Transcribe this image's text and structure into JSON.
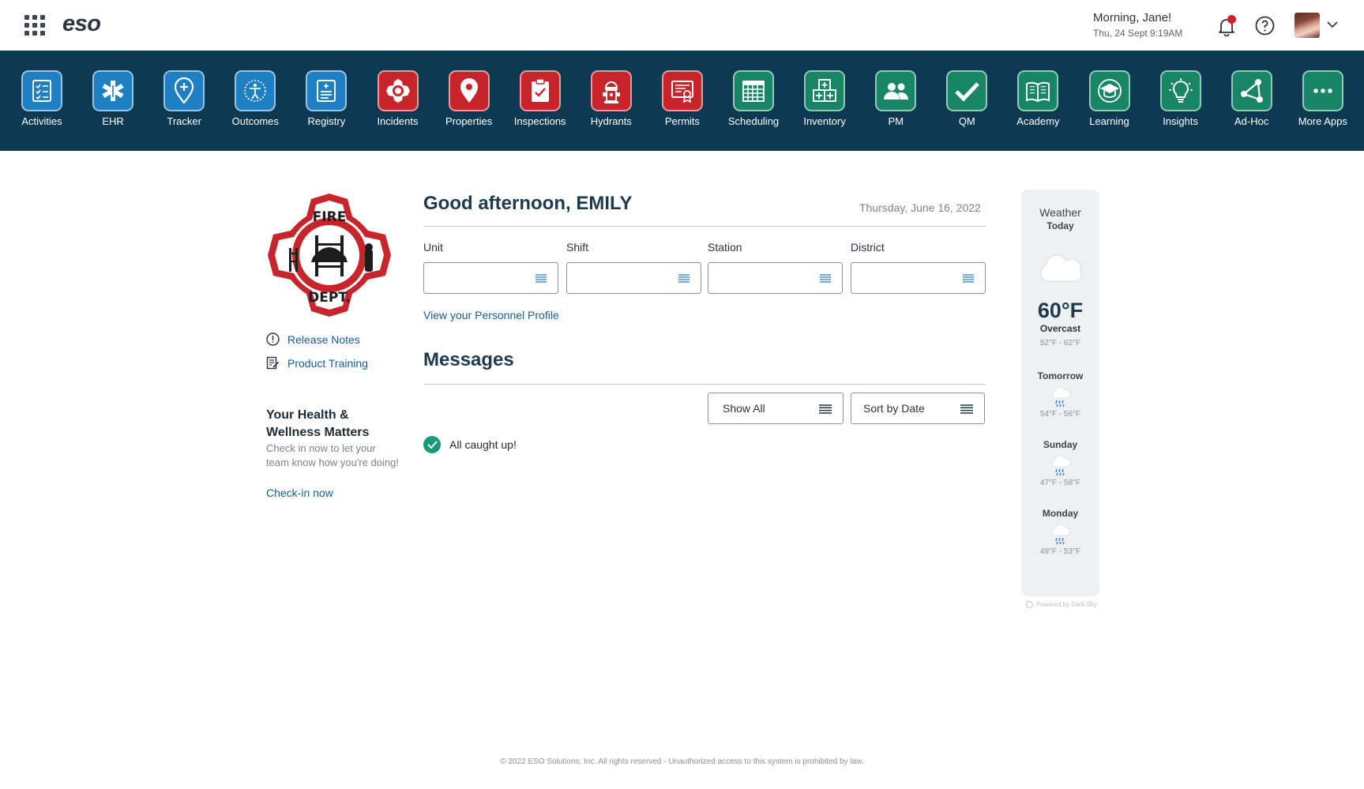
{
  "header": {
    "logo": "eso",
    "greeting": "Morning, Jane!",
    "datetime": "Thu, 24 Sept 9:19AM",
    "icons": [
      "apps-grid-icon",
      "bell-icon",
      "help-icon",
      "avatar",
      "chevron-down-icon"
    ],
    "notification_dot_color": "#d0202a"
  },
  "apps": [
    {
      "label": "Activities",
      "color": "blue",
      "icon": "checklist-icon"
    },
    {
      "label": "EHR",
      "color": "blue",
      "icon": "star-of-life-icon"
    },
    {
      "label": "Tracker",
      "color": "blue",
      "icon": "location-plus-icon"
    },
    {
      "label": "Outcomes",
      "color": "blue",
      "icon": "person-circle-icon"
    },
    {
      "label": "Registry",
      "color": "blue",
      "icon": "registry-icon"
    },
    {
      "label": "Incidents",
      "color": "red",
      "icon": "maltese-cross-icon"
    },
    {
      "label": "Properties",
      "color": "red",
      "icon": "map-pin-icon"
    },
    {
      "label": "Inspections",
      "color": "red",
      "icon": "clipboard-check-icon"
    },
    {
      "label": "Hydrants",
      "color": "red",
      "icon": "hydrant-icon"
    },
    {
      "label": "Permits",
      "color": "red",
      "icon": "certificate-icon"
    },
    {
      "label": "Scheduling",
      "color": "teal",
      "icon": "calendar-grid-icon"
    },
    {
      "label": "Inventory",
      "color": "teal",
      "icon": "boxes-plus-icon"
    },
    {
      "label": "PM",
      "color": "teal",
      "icon": "people-icon"
    },
    {
      "label": "QM",
      "color": "teal",
      "icon": "checkmark-icon"
    },
    {
      "label": "Academy",
      "color": "teal",
      "icon": "book-icon"
    },
    {
      "label": "Learning",
      "color": "teal",
      "icon": "graduation-cap-icon"
    },
    {
      "label": "Insights",
      "color": "teal",
      "icon": "lightbulb-icon"
    },
    {
      "label": "Ad-Hoc",
      "color": "teal",
      "icon": "nodes-icon"
    },
    {
      "label": "More Apps",
      "color": "teal",
      "icon": "ellipsis-icon"
    }
  ],
  "colors": {
    "blue": "#1e7fc2",
    "red": "#c8242c",
    "teal": "#178566",
    "ribbon": "#0d3a52",
    "link": "#135e96"
  },
  "badge": {
    "top_text": "FIRE",
    "bottom_text": "DEPT."
  },
  "side_links": {
    "release_notes": "Release Notes",
    "product_training": "Product Training"
  },
  "health": {
    "title": "Your Health & Wellness Matters",
    "text": "Check in now to let your team know how you're doing!",
    "link": "Check-in now"
  },
  "main": {
    "greeting": "Good afternoon, EMILY",
    "date": "Thursday, June 16, 2022",
    "filters": [
      {
        "label": "Unit",
        "value": ""
      },
      {
        "label": "Shift",
        "value": ""
      },
      {
        "label": "Station",
        "value": ""
      },
      {
        "label": "District",
        "value": ""
      }
    ],
    "profile_link": "View your Personnel Profile",
    "messages_title": "Messages",
    "show_all": "Show All",
    "sort": "Sort by Date",
    "empty_state": "All caught up!"
  },
  "weather": {
    "title": "Weather",
    "today_label": "Today",
    "today_temp": "60°F",
    "today_condition": "Overcast",
    "today_range": "52°F - 62°F",
    "forecast": [
      {
        "day": "Tomorrow",
        "range": "54°F - 56°F",
        "icon": "rain-icon"
      },
      {
        "day": "Sunday",
        "range": "47°F - 58°F",
        "icon": "rain-icon"
      },
      {
        "day": "Monday",
        "range": "49°F - 53°F",
        "icon": "rain-icon"
      }
    ],
    "powered_by": "Powered by Dark Sky"
  },
  "footer": "© 2022 ESO Solutions, Inc. All rights reserved - Unauthorized access to this system is prohibited by law."
}
